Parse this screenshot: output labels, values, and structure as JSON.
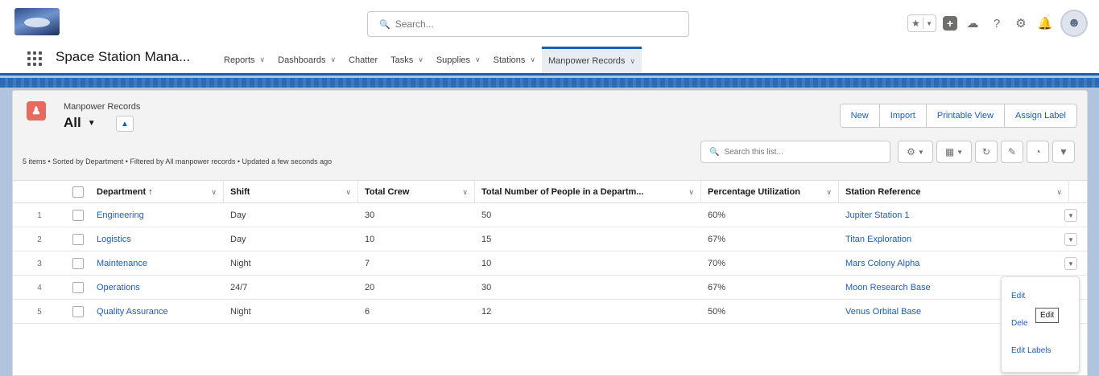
{
  "header": {
    "search_placeholder": "Search...",
    "help_glyph": "?"
  },
  "nav": {
    "app_name": "Space Station Mana...",
    "tabs": [
      {
        "label": "Reports",
        "has_menu": true
      },
      {
        "label": "Dashboards",
        "has_menu": true
      },
      {
        "label": "Chatter",
        "has_menu": false
      },
      {
        "label": "Tasks",
        "has_menu": true
      },
      {
        "label": "Supplies",
        "has_menu": true
      },
      {
        "label": "Stations",
        "has_menu": true
      },
      {
        "label": "Manpower Records",
        "has_menu": true,
        "active": true
      }
    ]
  },
  "list_view": {
    "object_label": "Manpower Records",
    "view_name": "All",
    "info": "5 items • Sorted by Department • Filtered by All manpower records • Updated a few seconds ago",
    "actions": [
      "New",
      "Import",
      "Printable View",
      "Assign Label"
    ],
    "search_placeholder": "Search this list..."
  },
  "table": {
    "columns": [
      "Department ↑",
      "Shift",
      "Total Crew",
      "Total Number of People in a Departm...",
      "Percentage Utilization",
      "Station Reference"
    ],
    "rows": [
      {
        "n": "1",
        "department": "Engineering",
        "shift": "Day",
        "crew": "30",
        "people": "50",
        "util": "60%",
        "station": "Jupiter Station 1"
      },
      {
        "n": "2",
        "department": "Logistics",
        "shift": "Day",
        "crew": "10",
        "people": "15",
        "util": "67%",
        "station": "Titan Exploration"
      },
      {
        "n": "3",
        "department": "Maintenance",
        "shift": "Night",
        "crew": "7",
        "people": "10",
        "util": "70%",
        "station": "Mars Colony Alpha"
      },
      {
        "n": "4",
        "department": "Operations",
        "shift": "24/7",
        "crew": "20",
        "people": "30",
        "util": "67%",
        "station": "Moon Research Base"
      },
      {
        "n": "5",
        "department": "Quality Assurance",
        "shift": "Night",
        "crew": "6",
        "people": "12",
        "util": "50%",
        "station": "Venus Orbital Base"
      }
    ]
  },
  "row_menu": {
    "items": [
      "Edit",
      "Dele",
      "Edit Labels"
    ],
    "tooltip": "Edit"
  },
  "colors": {
    "brand_blue": "#1b5fb0",
    "object_icon": "#e86a5e"
  }
}
